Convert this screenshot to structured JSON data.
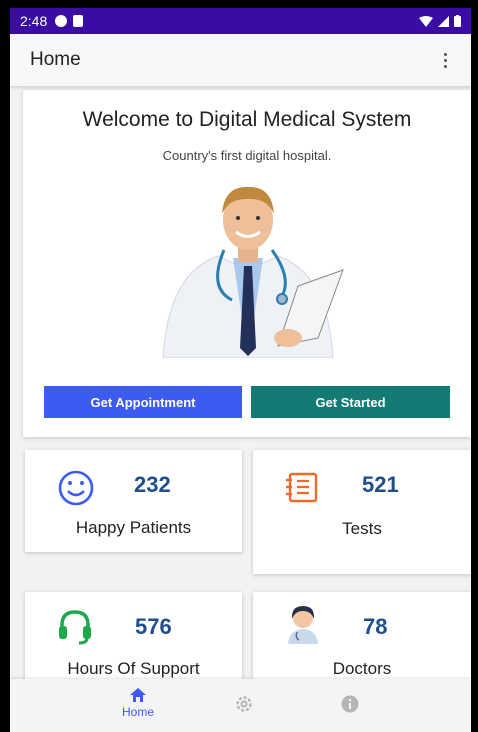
{
  "status_bar": {
    "time": "2:48"
  },
  "app_bar": {
    "title": "Home"
  },
  "hero": {
    "title": "Welcome to Digital Medical System",
    "subtitle": "Country's first digital hospital.",
    "appointment_button": "Get Appointment",
    "started_button": "Get Started"
  },
  "stats": [
    {
      "value": "232",
      "label": "Happy Patients",
      "icon": "smiley-icon"
    },
    {
      "value": "521",
      "label": "Tests",
      "icon": "clipboard-icon"
    },
    {
      "value": "576",
      "label": "Hours Of Support",
      "icon": "headset-icon"
    },
    {
      "value": "78",
      "label": "Doctors",
      "icon": "doctor-avatar-icon"
    }
  ],
  "bottom_nav": {
    "items": [
      {
        "label": "Home",
        "icon": "home-icon",
        "active": true
      },
      {
        "label": "",
        "icon": "settings-icon",
        "active": false
      },
      {
        "label": "",
        "icon": "info-icon",
        "active": false
      }
    ]
  },
  "colors": {
    "status_bar": "#3a0ca3",
    "primary_button": "#3d5af1",
    "secondary_button": "#117b74",
    "stat_number": "#1e4e8c",
    "active_nav": "#3d5af1"
  }
}
